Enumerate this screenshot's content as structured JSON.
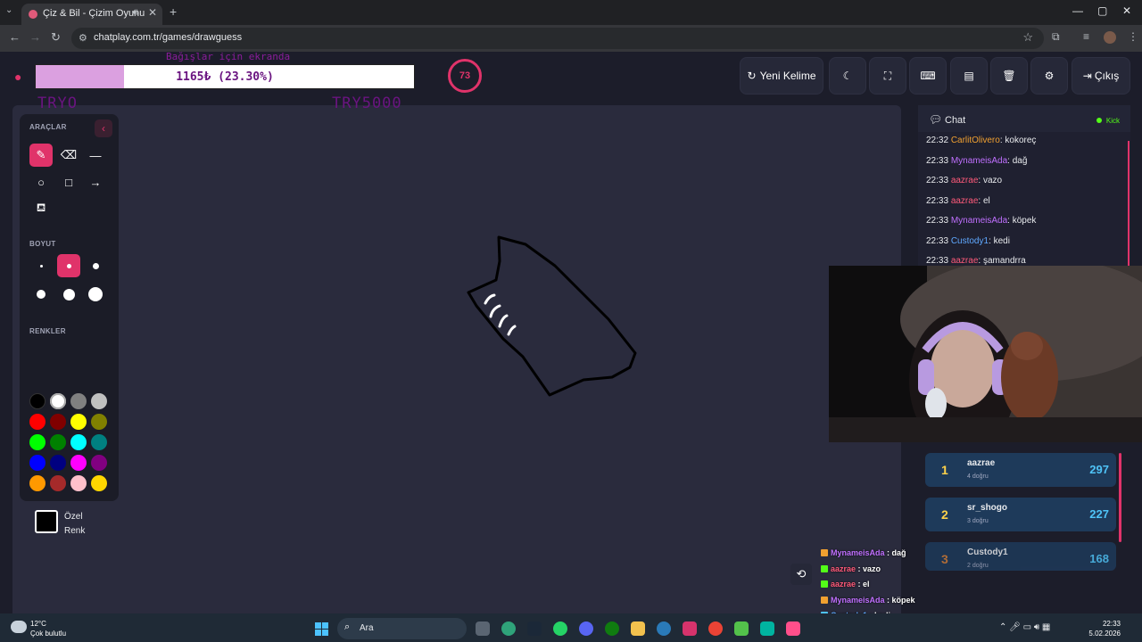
{
  "browser": {
    "tab_title": "Çiz & Bil - Çizim Oyunu",
    "url": "chatplay.com.tr/games/drawguess"
  },
  "stream_overlay": {
    "goal_text": "1165₺ (23.30%)",
    "goal_progress_percent": 23.3,
    "goal_ghost_top": "Bağışlar için ekranda",
    "goal_ghost_left": "TRYO",
    "goal_ghost_right": "TRY5000"
  },
  "toolbar": {
    "timer": "73",
    "new_word_label": "Yeni Kelime",
    "exit_label": "Çıkış"
  },
  "tools_panel": {
    "tools_title": "ARAÇLAR",
    "size_title": "BOYUT",
    "colors_title": "RENKLER",
    "custom_color_label": "Özel Renk",
    "colors": [
      "#000000",
      "#ffffff",
      "#808080",
      "#c0c0c0",
      "#ff0000",
      "#800000",
      "#ffff00",
      "#808000",
      "#00ff00",
      "#008000",
      "#00ffff",
      "#008080",
      "#0000ff",
      "#000080",
      "#ff00ff",
      "#800080",
      "#ff9900",
      "#a52a2a",
      "#ffc0cb",
      "#ffd700"
    ]
  },
  "chat": {
    "title": "Chat",
    "platform": "Kick",
    "messages": [
      {
        "time": "22:32",
        "user": "CarlitOlivero",
        "user_color": "#f0a030",
        "text": ": kokoreç"
      },
      {
        "time": "22:33",
        "user": "MynameisAda",
        "user_color": "#c070ff",
        "text": ": dağ"
      },
      {
        "time": "22:33",
        "user": "aazrae",
        "user_color": "#ff5a7a",
        "text": ": vazo"
      },
      {
        "time": "22:33",
        "user": "aazrae",
        "user_color": "#ff5a7a",
        "text": ": el"
      },
      {
        "time": "22:33",
        "user": "MynameisAda",
        "user_color": "#c070ff",
        "text": ": köpek"
      },
      {
        "time": "22:33",
        "user": "Custody1",
        "user_color": "#5fa8ff",
        "text": ": kedi"
      },
      {
        "time": "22:33",
        "user": "aazrae",
        "user_color": "#ff5a7a",
        "text": ": şamandrra"
      }
    ]
  },
  "leaderboard": [
    {
      "rank": "1",
      "name": "aazrae",
      "sub": "4 doğru",
      "score": "297"
    },
    {
      "rank": "2",
      "name": "sr_shogo",
      "sub": "3 doğru",
      "score": "227"
    },
    {
      "rank": "3",
      "name": "Custody1",
      "sub": "2 doğru",
      "score": "168"
    }
  ],
  "overlay_chat": [
    {
      "user": "MynameisAda",
      "user_color": "#c070ff",
      "text": " : dağ"
    },
    {
      "user": "aazrae",
      "user_color": "#ff5a7a",
      "text": " : vazo"
    },
    {
      "user": "aazrae",
      "user_color": "#ff5a7a",
      "text": " : el"
    },
    {
      "user": "MynameisAda",
      "user_color": "#c070ff",
      "text": " : köpek"
    },
    {
      "user": "Custody1",
      "user_color": "#5fa8ff",
      "text": " : kedi"
    },
    {
      "user": "aazrae",
      "user_color": "#ff5a7a",
      "text": " : şamandrra"
    }
  ],
  "taskbar": {
    "temperature": "12°C",
    "weather": "Çok bulutlu",
    "search_placeholder": "Ara",
    "time": "22:33",
    "date": "5.02.2026"
  }
}
